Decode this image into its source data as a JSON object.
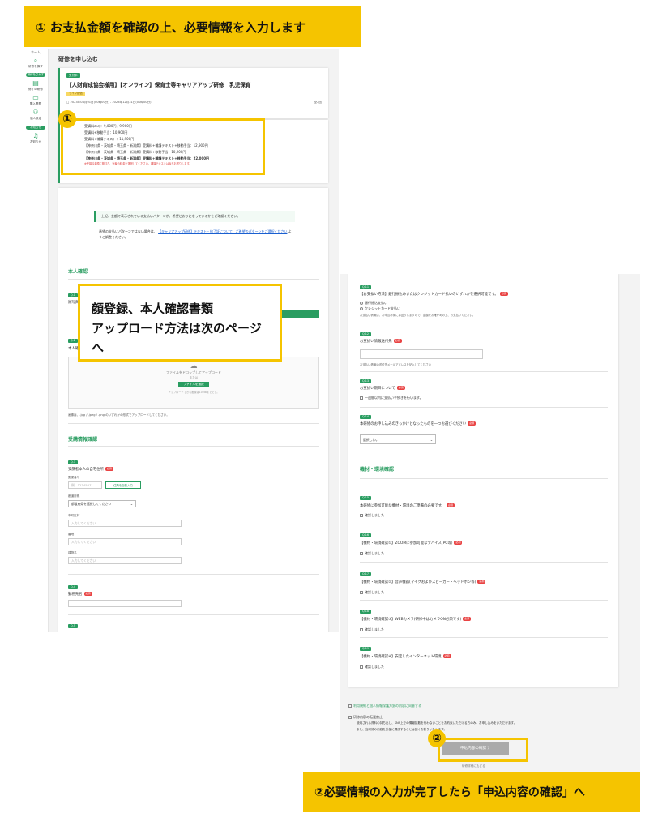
{
  "banners": {
    "top": "① お支払金額を確認の上、必要情報を入力します",
    "bottom": "②必要情報の入力が完了したら「申込内容の確認」へ"
  },
  "callout": {
    "line1": "顔登録、本人確認書類",
    "line2": "アップロード方法は次のページへ"
  },
  "markers": {
    "one": "①",
    "two": "②"
  },
  "sidebar": {
    "home": "ホーム",
    "pill1": "研修をさがす",
    "pill2": "お知らせ",
    "items": [
      {
        "icon": "search-icon",
        "glyph": "⌕",
        "label": "研修を探す"
      },
      {
        "icon": "document-icon",
        "glyph": "▤",
        "label": "修了の研修"
      },
      {
        "icon": "card-icon",
        "glyph": "▭",
        "label": "購入履歴"
      },
      {
        "icon": "user-icon",
        "glyph": "⚇",
        "label": "個人設定"
      },
      {
        "icon": "bell-icon",
        "glyph": "♫",
        "label": "お知らせ"
      }
    ]
  },
  "left": {
    "page_title": "研修を申し込む",
    "course": {
      "tag": "受付中",
      "title": "【人財育成協会様用】【オンライン】保育士等キャリアアップ研修　乳児保育",
      "sub_tag": "ライブ配信",
      "period": "□ 2023年04月01日(00時00分) - 2023年12月31日(00時00分)",
      "count": "全2回"
    },
    "fees": [
      {
        "text": "受講料のみ：9,000円 / 9,900円",
        "bold": false
      },
      {
        "text": "受講料+移動手当：10,900円",
        "bold": false
      },
      {
        "text": "受講料+補講テキスト：11,900円",
        "bold": false
      },
      {
        "text": "【神奈川県・茨城県・埼玉県・新潟県】受講料+補講テキスト+移動手当：12,900円",
        "bold": false
      },
      {
        "text": "【神奈川県・茨城県・埼玉県・新潟県】受講料+移動手当：10,900円",
        "bold": false
      },
      {
        "text": "【神奈川県・茨城県・埼玉県・新潟県】受講料+補講テキスト+移動手当：22,000円",
        "bold": true
      }
    ],
    "fee_note": "※受講料金額に基づき、対象の料金を選択してください。補講テキストは後日お送りします。",
    "notice1": "上記、金額で表示されている支払いパターンが、希望どおりになっているかをご確認ください。",
    "notice2a": "希望の支払いパターンではない場合は、",
    "notice2_link": "【キャリアアップ研修】テキスト・修了証について、ご希望のパターンをご選択ください",
    "notice2b": "ようご調整ください。",
    "section_identity": "本人確認",
    "q_face": "Q.1",
    "q_face_label": "顔写真",
    "q_id": "Q.2",
    "q_id_label": "本人確認書類",
    "upload_text": "ファイルをドロップしてアップロード",
    "upload_or": "または",
    "upload_btn": "ファイルを選択",
    "upload_hint": "アップロードできる画像は10MBまでです。",
    "upload_ext": "画像は、.jpg / .jpeg / .png のいずれかの形式でアップロードしてください。",
    "section_attendee": "受講情報確認",
    "q3": "Q.3",
    "q3_label": "受講者本人の自宅住所",
    "postal_label": "郵便番号",
    "postal_placeholder": "例）1234567",
    "postal_btn": "住所を自動入力",
    "pref_label": "都道府県",
    "pref_value": "都道府県を選択してください",
    "city_label": "市町区村",
    "city_placeholder": "入力してください",
    "addr_label": "番地",
    "addr_placeholder": "入力してください",
    "bldg_label": "建物名",
    "bldg_placeholder": "入力してください",
    "q4": "Q.4",
    "q4_label": "勤務先名",
    "q5": "Q.5",
    "req": "必須"
  },
  "right": {
    "q11": "Q.11",
    "q11_label": "【お支払い方法】銀行振込みまたはクレジットカード払いのいずれかを選択可能です。",
    "q11_opt1": "銀行振込支払い",
    "q11_opt2": "クレジットカード支払い",
    "q11_note": "お支払い情報は、お申込み後にお送りしますので、金額をお確かめの上、お支払いください。",
    "q12": "Q.12",
    "q12_label": "お支払い情報送付先",
    "q12_note": "お支払い情報の送付先メールアドレスを記入してください",
    "q13": "Q.13",
    "q13_label": "お支払い期日について",
    "q13_opt": "一週間以内に支払い手続きを行います。",
    "q14": "Q.14",
    "q14_label": "本研修のお申し込みのきっかけとなったものを一つお選びください",
    "q14_select": "選択しない",
    "section_env": "機材・環境確認",
    "q15": "Q.15",
    "q15_label": "本研修に参加可能な機材・環境のご準備の必要です。",
    "q16": "Q.16",
    "q16_label": "【機材・環境確認①】ZOOMに参加可能なデバイス(PC等)",
    "q17": "Q.17",
    "q17_label": "【機材・環境確認②】音声機器(マイクおよびスピーカー・ヘッドホン等)",
    "q18": "Q.18",
    "q18_label": "【機材・環境確認③】WEBカメラ(研修中はカメラON必須です)",
    "q19": "Q.19",
    "q19_label": "【機材・環境確認④】安定したインターネット環境",
    "confirm": "確認しました",
    "agree1": "利用規約と個人情報保護方針の内容に同意する",
    "agree2": "研修内容の転載禁止",
    "agree2_text1": "使用される資料の持ち出し、SNS上での情報拡散を行わないことをお約束いただける方のみ、お申し込みをいただけます。",
    "agree2_text2": "また、当研修の内容を外部に漏洩することは固くお断りいたします。",
    "submit": "申込内容の確認 〉",
    "back": "研修詳細にもどる",
    "req": "必須"
  }
}
